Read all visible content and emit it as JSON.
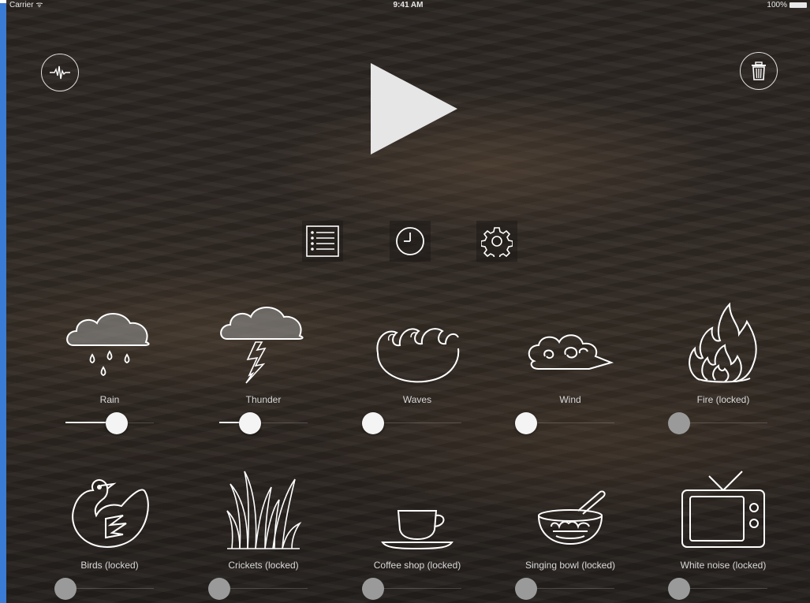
{
  "status_bar": {
    "carrier": "Carrier ᯤ",
    "time": "9:41 AM",
    "battery": "100%"
  },
  "top_controls": {
    "left_icon": "waveform-icon",
    "play_icon": "play-icon",
    "right_icon": "trash-icon"
  },
  "toolbar": [
    {
      "icon": "list-icon"
    },
    {
      "icon": "clock-icon"
    },
    {
      "icon": "gear-icon"
    }
  ],
  "sounds": [
    {
      "label": "Rain",
      "icon": "rain-cloud-icon",
      "volume": 0.58,
      "locked": false
    },
    {
      "label": "Thunder",
      "icon": "thunder-cloud-icon",
      "volume": 0.35,
      "locked": false
    },
    {
      "label": "Waves",
      "icon": "waves-icon",
      "volume": 0.0,
      "locked": false
    },
    {
      "label": "Wind",
      "icon": "wind-icon",
      "volume": 0.0,
      "locked": false
    },
    {
      "label": "Fire (locked)",
      "icon": "fire-icon",
      "volume": 0.0,
      "locked": true
    },
    {
      "label": "Birds (locked)",
      "icon": "bird-icon",
      "volume": 0.0,
      "locked": true
    },
    {
      "label": "Crickets (locked)",
      "icon": "grass-icon",
      "volume": 0.0,
      "locked": true
    },
    {
      "label": "Coffee shop (locked)",
      "icon": "coffee-cup-icon",
      "volume": 0.0,
      "locked": true
    },
    {
      "label": "Singing bowl (locked)",
      "icon": "singing-bowl-icon",
      "volume": 0.0,
      "locked": true
    },
    {
      "label": "White noise (locked)",
      "icon": "tv-icon",
      "volume": 0.0,
      "locked": true
    }
  ],
  "colors": {
    "accent": "#f4f4f4",
    "locked_thumb": "#9a9a9a",
    "frame": "#3a7bd5"
  }
}
